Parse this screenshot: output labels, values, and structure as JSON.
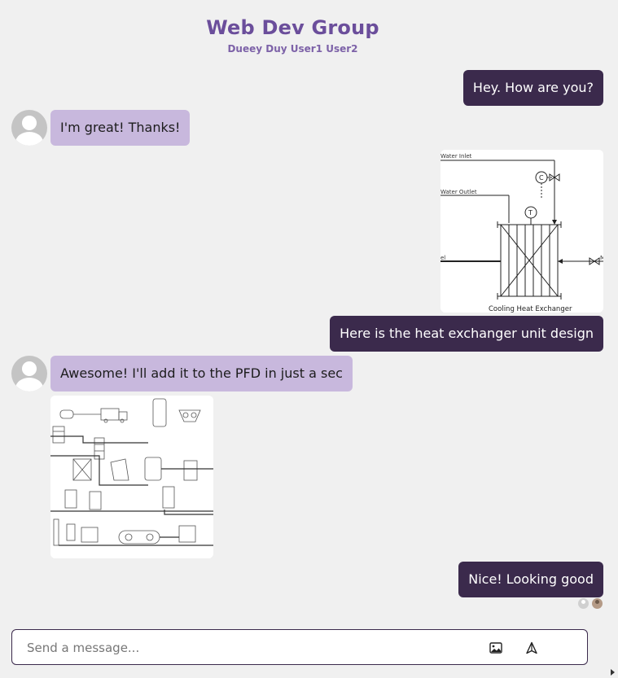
{
  "header": {
    "title": "Web Dev Group",
    "members": "Dueey Duy User1 User2"
  },
  "messages": [
    {
      "direction": "out",
      "text": "Hey. How are you?"
    },
    {
      "direction": "in",
      "text": "I'm great! Thanks!"
    },
    {
      "direction": "out",
      "image": "heat-exchanger-diagram",
      "image_caption": "Cooling Heat Exchanger",
      "image_labels": [
        "Water Inlet",
        "Water Outlet",
        "C",
        "T",
        "el",
        "M"
      ]
    },
    {
      "direction": "out",
      "text": "Here is the heat exchanger unit design"
    },
    {
      "direction": "in",
      "text": "Awesome! I'll add it to the PFD in just a sec"
    },
    {
      "direction": "in",
      "image": "pfd-diagram"
    },
    {
      "direction": "out",
      "text": "Nice! Looking good"
    }
  ],
  "composer": {
    "placeholder": "Send a message...",
    "value": "",
    "image_icon": "image-icon",
    "send_icon": "send-icon"
  },
  "colors": {
    "title": "#6b4e9b",
    "outgoing_bubble": "#3b2a4c",
    "incoming_bubble": "#c8b8dd",
    "background": "#f0f0f0"
  }
}
